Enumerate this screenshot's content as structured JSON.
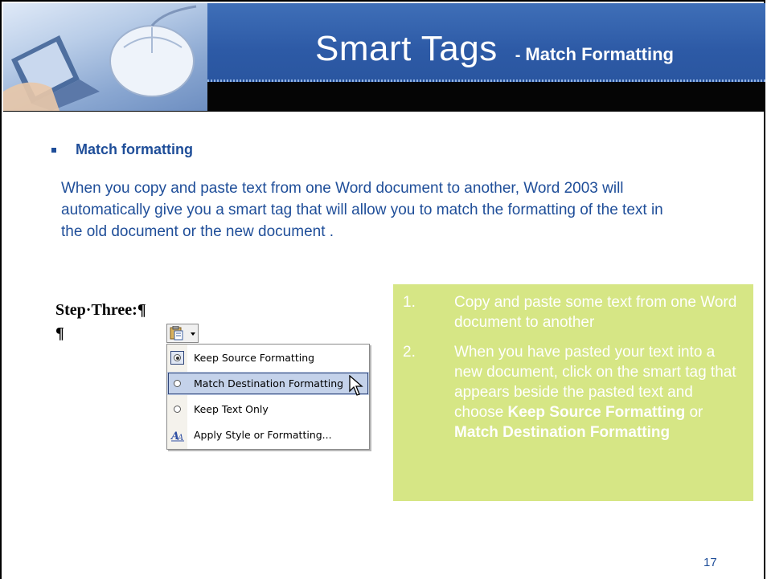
{
  "header": {
    "title": "Smart Tags",
    "separator": "-",
    "subtitle": "Match Formatting"
  },
  "section": {
    "bullet_heading": "Match formatting",
    "paragraph": "When you copy and paste text from one Word document to another, Word 2003 will automatically give you a smart tag that will allow you to match the formatting of the text in the old document or the new document ."
  },
  "screenshot": {
    "step_label": "Step·Three:¶",
    "cursor_text": "¶",
    "menu_items": [
      {
        "label": "Keep Source Formatting",
        "icon": "radio-checked-icon"
      },
      {
        "label": "Match Destination Formatting",
        "icon": "radio-icon"
      },
      {
        "label": "Keep Text Only",
        "icon": "radio-icon"
      },
      {
        "label": "Apply Style or Formatting...",
        "icon": "style-icon"
      }
    ]
  },
  "steps": [
    {
      "num": "1.",
      "text": "Copy and paste some text from one Word document to another"
    },
    {
      "num": "2.",
      "text_before": "When you have pasted your text into a new document, click on the smart tag that appears beside the pasted text and choose ",
      "bold1": "Keep Source Formatting",
      "text_middle": " or ",
      "bold2": "Match Destination Formatting"
    }
  ],
  "page_number": "17",
  "colors": {
    "header_blue": "#2d5aa6",
    "text_blue": "#1f4e99",
    "steps_box": "#d6e685"
  }
}
